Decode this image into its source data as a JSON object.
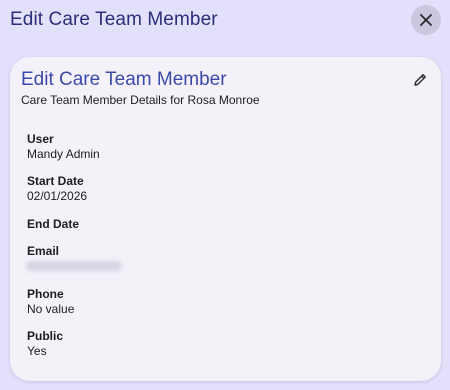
{
  "dialog": {
    "title": "Edit Care Team Member",
    "close_icon": "close-icon"
  },
  "card": {
    "title": "Edit Care Team Member",
    "subtitle": "Care Team Member Details for Rosa Monroe",
    "edit_icon": "pencil-icon",
    "fields": [
      {
        "label": "User",
        "value": "Mandy Admin"
      },
      {
        "label": "Start Date",
        "value": "02/01/2026"
      },
      {
        "label": "End Date",
        "value": ""
      },
      {
        "label": "Email",
        "value": ""
      },
      {
        "label": "Phone",
        "value": "No value"
      },
      {
        "label": "Public",
        "value": "Yes"
      }
    ]
  },
  "colors": {
    "background": "#e2e0fa",
    "card": "#f4f1f9",
    "accent": "#3b4aa8",
    "header_title": "#2c2f7a"
  }
}
